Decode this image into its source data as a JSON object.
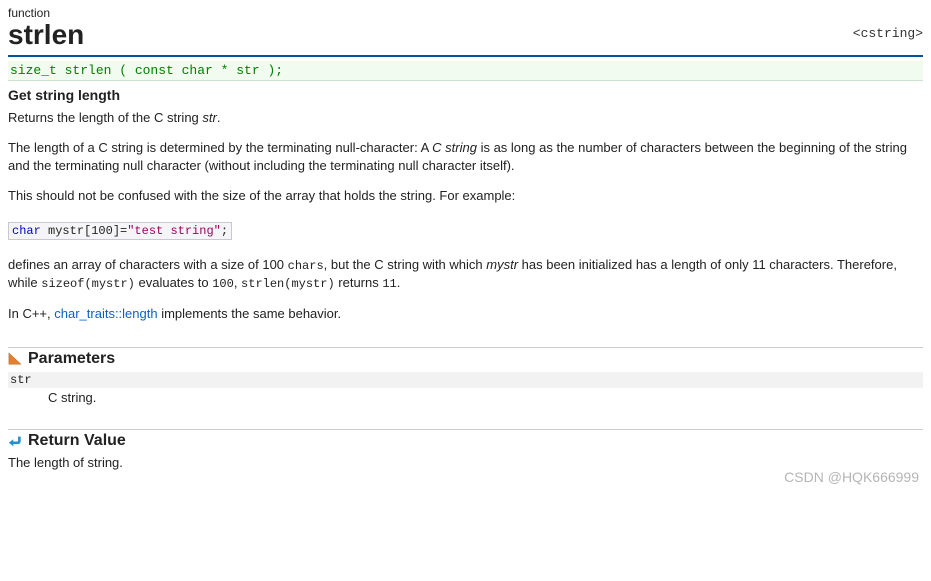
{
  "header": {
    "kind": "function",
    "name": "strlen",
    "include": "<cstring>"
  },
  "signature": "size_t strlen ( const char * str );",
  "subtitle": "Get string length",
  "p1_a": "Returns the length of the C string ",
  "p1_b": "str",
  "p1_c": ".",
  "p2_a": "The length of a C string is determined by the terminating null-character: A ",
  "p2_b": "C string",
  "p2_c": " is as long as the number of characters between the beginning of the string and the terminating null character (without including the terminating null character itself).",
  "p3": "This should not be confused with the size of the array that holds the string. For example:",
  "code": {
    "kw": "char",
    "decl": " mystr[100]=",
    "str": "\"test string\"",
    "tail": ";"
  },
  "p4_pre": "defines an array of characters with a size of 100 ",
  "p4_chars": "chars",
  "p4_mid": ", but the C string with which ",
  "p4_mystr": "mystr",
  "p4_after": " has been initialized has a length of only 11 characters. Therefore, while ",
  "p4_sizeof": "sizeof(mystr)",
  "p4_eval": " evaluates to ",
  "p4_100": "100",
  "p4_comma": ", ",
  "p4_strlen": "strlen(mystr)",
  "p4_returns": " returns ",
  "p4_11": "11",
  "p4_end": ".",
  "p5_pre": "In C++, ",
  "p5_link": "char_traits::length",
  "p5_post": " implements the same behavior.",
  "sections": {
    "params_title": "Parameters",
    "return_title": "Return Value"
  },
  "params": {
    "name": "str",
    "desc": "C string."
  },
  "return_desc": "The length of string.",
  "watermark": "CSDN @HQK666999"
}
